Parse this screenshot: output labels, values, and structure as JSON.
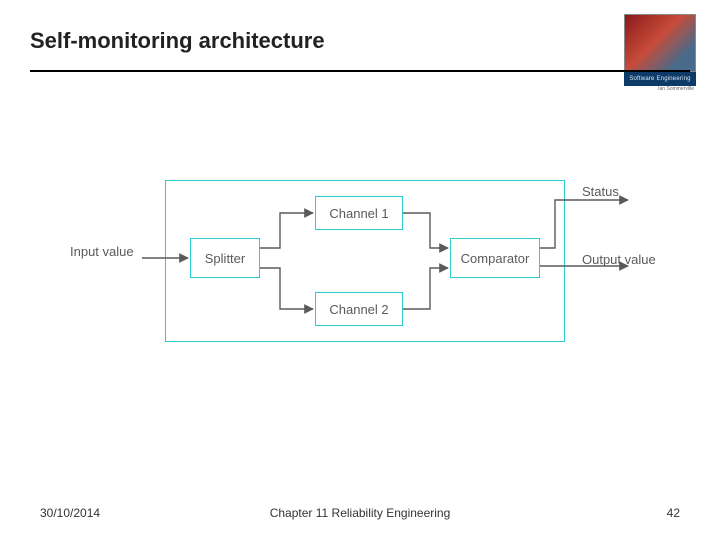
{
  "header": {
    "title": "Self-monitoring architecture",
    "cover_label": "Software Engineering",
    "cover_author": "Ian Sommerville"
  },
  "diagram": {
    "input_label": "Input value",
    "splitter_label": "Splitter",
    "channel1_label": "Channel 1",
    "channel2_label": "Channel 2",
    "comparator_label": "Comparator",
    "status_label": "Status",
    "output_label": "Output value"
  },
  "footer": {
    "date": "30/10/2014",
    "chapter": "Chapter 11 Reliability Engineering",
    "page": "42"
  }
}
